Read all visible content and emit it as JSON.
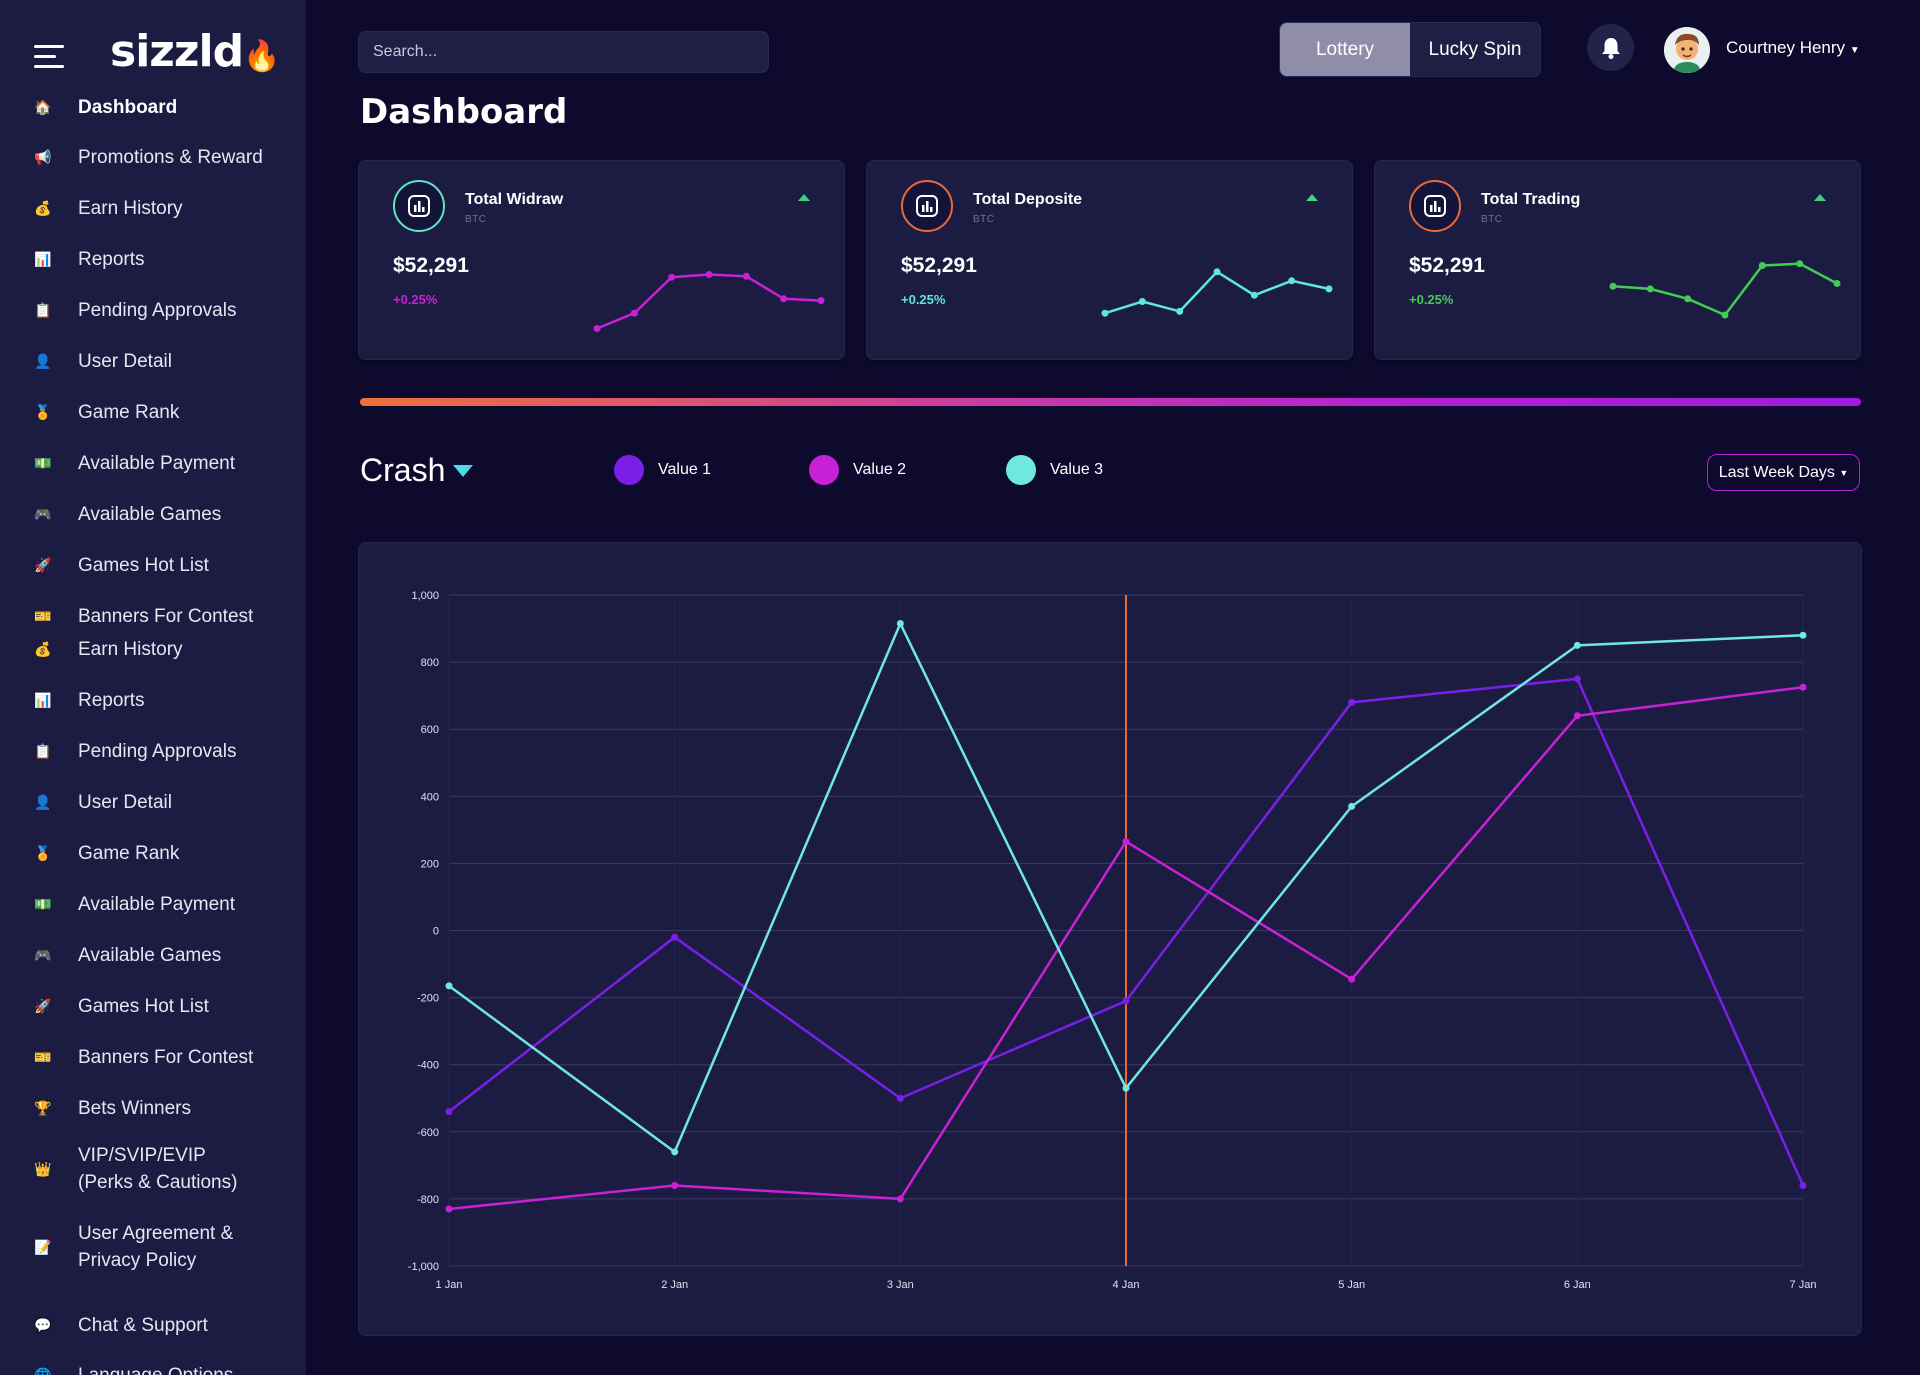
{
  "brand": {
    "logo_text": "sizzld"
  },
  "sidebar": {
    "items": [
      {
        "label": "Dashboard",
        "icon": "home-icon",
        "active": true
      },
      {
        "label": "Promotions & Reward",
        "icon": "promotion-icon"
      },
      {
        "label": "Earn History",
        "icon": "coins-icon"
      },
      {
        "label": "Reports",
        "icon": "reports-icon"
      },
      {
        "label": "Pending Approvals",
        "icon": "approvals-icon"
      },
      {
        "label": "User Detail",
        "icon": "user-icon"
      },
      {
        "label": "Game Rank",
        "icon": "rank-icon"
      },
      {
        "label": "Available Payment",
        "icon": "payment-icon"
      },
      {
        "label": "Available Games",
        "icon": "games-icon"
      },
      {
        "label": "Games Hot List",
        "icon": "hot-list-icon"
      },
      {
        "label": "Banners For Contest",
        "icon": "banner-icon"
      },
      {
        "label": "Earn History",
        "icon": "coins-icon"
      },
      {
        "label": "Reports",
        "icon": "reports-icon"
      },
      {
        "label": "Pending Approvals",
        "icon": "approvals-icon"
      },
      {
        "label": "User Detail",
        "icon": "user-icon"
      },
      {
        "label": "Game Rank",
        "icon": "rank-icon"
      },
      {
        "label": "Available Payment",
        "icon": "payment-icon"
      },
      {
        "label": "Available Games",
        "icon": "games-icon"
      },
      {
        "label": "Games Hot List",
        "icon": "hot-list-icon"
      },
      {
        "label": "Banners For Contest",
        "icon": "banner-icon"
      },
      {
        "label": "Bets Winners",
        "icon": "trophy-icon"
      },
      {
        "label": "VIP/SVIP/EVIP",
        "label2": "(Perks & Cautions)",
        "icon": "vip-icon"
      },
      {
        "label": "User Agreement &",
        "label2": "Privacy Policy",
        "icon": "agreement-icon"
      },
      {
        "label": "Chat & Support",
        "icon": "support-icon"
      },
      {
        "label": "Language Options",
        "icon": "language-icon"
      }
    ]
  },
  "header": {
    "search_placeholder": "Search...",
    "toggle": [
      {
        "label": "Lottery",
        "active": true
      },
      {
        "label": "Lucky Spin",
        "active": false
      }
    ],
    "user_name": "Courtney Henry"
  },
  "page": {
    "title": "Dashboard"
  },
  "cards": [
    {
      "title": "Total Widraw",
      "sub": "BTC",
      "value": "$52,291",
      "change": "+0.25%",
      "color": "#c821d6",
      "icon": "withdraw-icon",
      "spark": [
        5,
        22,
        62,
        65,
        63,
        38,
        36
      ]
    },
    {
      "title": "Total Deposite",
      "sub": "BTC",
      "value": "$52,291",
      "change": "+0.25%",
      "color": "#5ee6e0",
      "icon": "deposit-chart-icon",
      "spark": [
        22,
        35,
        24,
        68,
        42,
        58,
        49
      ]
    },
    {
      "title": "Total Trading",
      "sub": "BTC",
      "value": "$52,291",
      "change": "+0.25%",
      "color": "#42cc52",
      "icon": "trading-chart-icon",
      "spark": [
        52,
        49,
        38,
        20,
        75,
        77,
        55
      ]
    }
  ],
  "crash": {
    "title": "Crash",
    "range_label": "Last Week Days"
  },
  "chart_data": {
    "type": "line",
    "x": [
      "1 Jan",
      "2 Jan",
      "3 Jan",
      "4 Jan",
      "5 Jan",
      "6 Jan",
      "7 Jan"
    ],
    "series": [
      {
        "name": "Value 1",
        "color": "#7a1fe8",
        "values": [
          -540,
          -20,
          -500,
          -210,
          680,
          750,
          -760
        ]
      },
      {
        "name": "Value 2",
        "color": "#c821d6",
        "values": [
          -830,
          -760,
          -800,
          265,
          -145,
          640,
          725
        ]
      },
      {
        "name": "Value 3",
        "color": "#6ee8e0",
        "values": [
          -165,
          -660,
          915,
          -470,
          370,
          850,
          880
        ]
      }
    ],
    "ylim": [
      -1000,
      1000
    ],
    "yticks": [
      "1,000",
      "800",
      "600",
      "400",
      "200",
      "0",
      "-200",
      "-400",
      "-600",
      "-800",
      "-1,000"
    ],
    "marker_x": "4 Jan",
    "marker_color": "#e8693a",
    "grid": true
  }
}
